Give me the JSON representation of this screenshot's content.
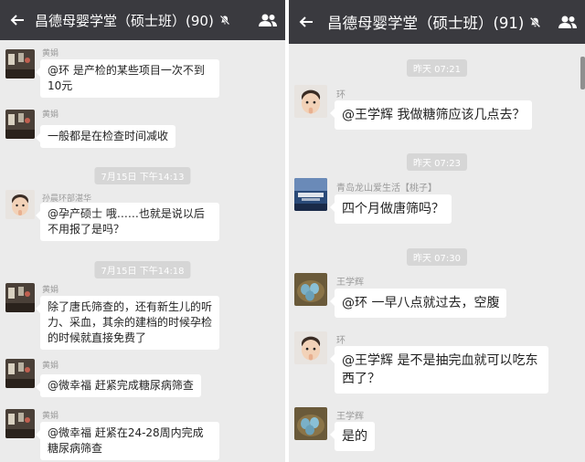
{
  "left": {
    "header": {
      "title": "昌德母婴学堂（硕士班）(90)"
    },
    "timestamps": [
      "7月15日 下午14:13",
      "7月15日 下午14:18"
    ],
    "messages": [
      {
        "sender": "黄娟",
        "text": "@环 是产检的某些项目一次不到10元",
        "avatar": "dark-room-avatar"
      },
      {
        "sender": "黄娟",
        "text": "一般都是在检查时间减收",
        "avatar": "dark-room-avatar"
      },
      {
        "sender": "孙晨环部湛华",
        "text": "@孕产硕士 哦……也就是说以后不用报了是吗？",
        "avatar": "baby-avatar"
      },
      {
        "sender": "黄娟",
        "text": "除了唐氏筛查的，还有新生儿的听力、采血，其余的建档的时候孕检的时候就直接免费了",
        "avatar": "dark-room-avatar"
      },
      {
        "sender": "黄娟",
        "text": "@微幸福 赶紧完成糖尿病筛查",
        "avatar": "dark-room-avatar"
      },
      {
        "sender": "黄娟",
        "text": "@微幸福 赶紧在24-28周内完成糖尿病筛查",
        "avatar": "dark-room-avatar"
      }
    ]
  },
  "right": {
    "header": {
      "title": "昌德母婴学堂（硕士班）(91)"
    },
    "timestamps": [
      "昨天 07:21",
      "昨天 07:23",
      "昨天 07:30"
    ],
    "messages": [
      {
        "sender": "环",
        "text": "@王学辉 我做糖筛应该几点去？",
        "avatar": "baby-avatar"
      },
      {
        "sender": "青岛龙山爱生活【桃子】",
        "text": "四个月做唐筛吗？",
        "avatar": "city-avatar"
      },
      {
        "sender": "王学辉",
        "text": "@环 一早八点就过去，空腹",
        "avatar": "eggs-avatar"
      },
      {
        "sender": "环",
        "text": "@王学辉 是不是抽完血就可以吃东西了？",
        "avatar": "baby-avatar"
      },
      {
        "sender": "王学辉",
        "text": "是的",
        "avatar": "eggs-avatar"
      }
    ]
  },
  "colors": {
    "header_bg": "#3a3a3f",
    "chat_bg": "#ebebeb",
    "bubble_bg": "#ffffff",
    "timestamp_bg": "#d6d6d6"
  },
  "icons": [
    "back-arrow-icon",
    "mute-icon",
    "group-members-icon"
  ]
}
